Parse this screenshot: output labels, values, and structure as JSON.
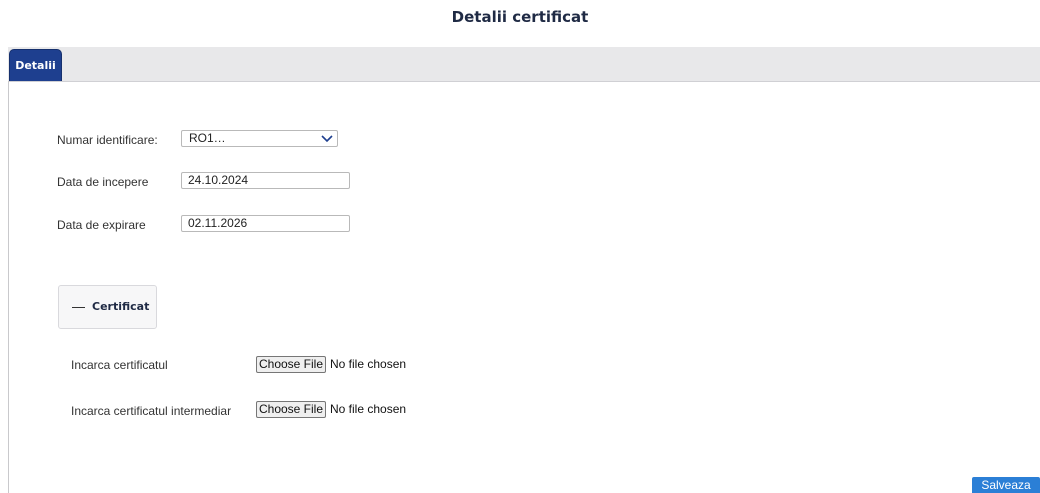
{
  "page": {
    "title": "Detalii certificat"
  },
  "tabs": [
    {
      "label": "Detalii",
      "active": true
    }
  ],
  "form": {
    "id_label": "Numar identificare:",
    "id_value": "RO1…",
    "start_label": "Data de incepere",
    "start_value": "24.10.2024",
    "expiry_label": "Data de expirare",
    "expiry_value": "02.11.2026"
  },
  "certificat_section": {
    "legend": "Certificat",
    "upload_cert_label": "Incarca certificatul",
    "upload_intermediate_label": "Incarca certificatul intermediar",
    "choose_file_label": "Choose File",
    "no_file_text": "No file chosen"
  },
  "actions": {
    "save_label": "Salveaza"
  },
  "colors": {
    "tab_active": "#1e3f8f",
    "save_button": "#2b7fd6",
    "chevron": "#1e3f8f"
  },
  "icons": {
    "select_arrow": "chevron-down-icon",
    "collapse": "minus-icon"
  }
}
